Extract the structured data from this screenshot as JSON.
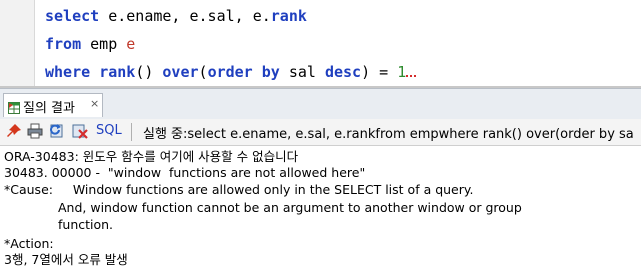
{
  "editor": {
    "line1": {
      "kw1": "select",
      "rest": " e.ename, e.sal, e.",
      "kw2": "rank"
    },
    "line2": {
      "kw": "from",
      "rest": " emp ",
      "alias": "e"
    },
    "line3": {
      "kw1": "where",
      "sp1": " ",
      "kw2": "rank",
      "rest1": "() ",
      "kw3": "over",
      "rest2": "(",
      "kw4": "order by",
      "rest3": " sal ",
      "kw5": "desc",
      "rest4": ") = ",
      "num": "1"
    }
  },
  "results_panel": {
    "tab_label": "질의 결과",
    "tab_close": "×",
    "toolbar": {
      "sql_label": "SQL",
      "separator": "|",
      "status": "실행 중:select e.ename, e.sal, e.rankfrom empwhere rank() over(order by sa"
    },
    "output_lines": [
      "ORA-30483: 윈도우 함수를 여기에 사용할 수 없습니다",
      "30483. 00000 -  \"window  functions are not allowed here\"",
      "*Cause:     Window functions are allowed only in the SELECT list of a query.",
      "And, window function cannot be an argument to another window or group",
      "function.",
      "*Action:",
      "3행, 7열에서 오류 발생"
    ]
  },
  "icons": {
    "tab": "results-grid-icon",
    "pin": "pin-icon",
    "print": "print-icon",
    "refresh": "refresh-icon",
    "clear": "clear-icon"
  },
  "colors": {
    "keyword": "#1f3fbf",
    "alias": "#c0392b",
    "number": "#2e8b2e",
    "error_squiggle": "#d42c2c"
  }
}
